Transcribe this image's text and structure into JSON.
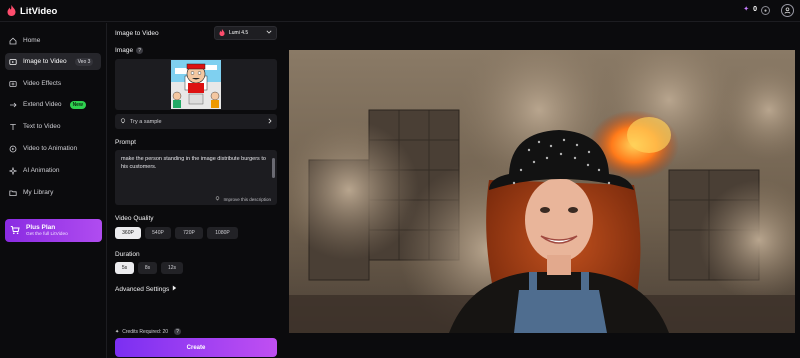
{
  "app": {
    "name": "LitVideo"
  },
  "header": {
    "credits": "0"
  },
  "sidebar": {
    "items": [
      {
        "label": "Home"
      },
      {
        "label": "Image to Video",
        "badge": "Veo 3"
      },
      {
        "label": "Video Effects"
      },
      {
        "label": "Extend Video",
        "badge": "New"
      },
      {
        "label": "Text to Video"
      },
      {
        "label": "Video to Animation"
      },
      {
        "label": "AI Animation"
      },
      {
        "label": "My Library"
      }
    ],
    "plus": {
      "title": "Plus Plan",
      "subtitle": "Get the full LitVideo"
    }
  },
  "panel": {
    "title": "Image to Video",
    "model": "Lumi 4.5",
    "image_label": "Image",
    "sample_label": "Try a sample",
    "prompt_label": "Prompt",
    "prompt_text": "make the person standing in the image distribute burgers to his customers.",
    "improve_label": "Improve this description",
    "quality_label": "Video Quality",
    "quality_options": [
      "360P",
      "540P",
      "720P",
      "1080P"
    ],
    "quality_selected": "360P",
    "duration_label": "Duration",
    "duration_options": [
      "5s",
      "8s",
      "12s"
    ],
    "duration_selected": "5s",
    "advanced_label": "Advanced Settings",
    "credits_required": "Credits Required: 20",
    "create_label": "Create"
  },
  "colors": {
    "accent": "#9b3ff0",
    "new_badge": "#2fd14f",
    "background": "#0b0b0d"
  }
}
